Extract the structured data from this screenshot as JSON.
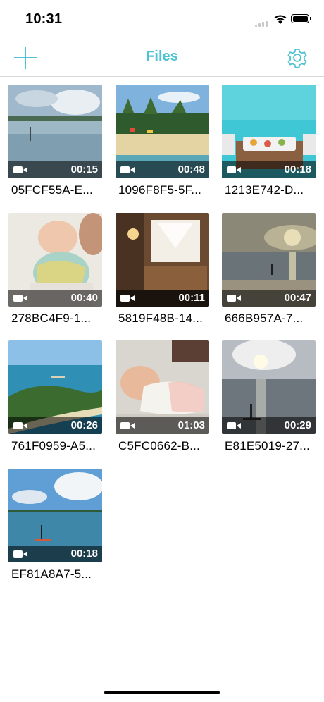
{
  "status": {
    "time": "10:31"
  },
  "nav": {
    "title": "Files",
    "add_icon": "plus-icon",
    "settings_icon": "gear-icon",
    "accent": "#4fc3d3"
  },
  "files": [
    {
      "name": "05FCF55A-E...",
      "duration": "00:15",
      "scene": "cloudy-sea"
    },
    {
      "name": "1096F8F5-5F...",
      "duration": "00:48",
      "scene": "palm-beach"
    },
    {
      "name": "1213E742-D...",
      "duration": "00:18",
      "scene": "pool-breakfast"
    },
    {
      "name": "278BC4F9-1...",
      "duration": "00:40",
      "scene": "baby-lying"
    },
    {
      "name": "5819F48B-14...",
      "duration": "00:11",
      "scene": "room-interior"
    },
    {
      "name": "666B957A-7...",
      "duration": "00:47",
      "scene": "sunset-beach"
    },
    {
      "name": "761F0959-A5...",
      "duration": "00:26",
      "scene": "island-aerial"
    },
    {
      "name": "C5FC0662-B...",
      "duration": "01:03",
      "scene": "baby-crawling"
    },
    {
      "name": "E81E5019-27...",
      "duration": "00:29",
      "scene": "sun-sea"
    },
    {
      "name": "EF81A8A7-5...",
      "duration": "00:18",
      "scene": "paddleboard"
    }
  ]
}
